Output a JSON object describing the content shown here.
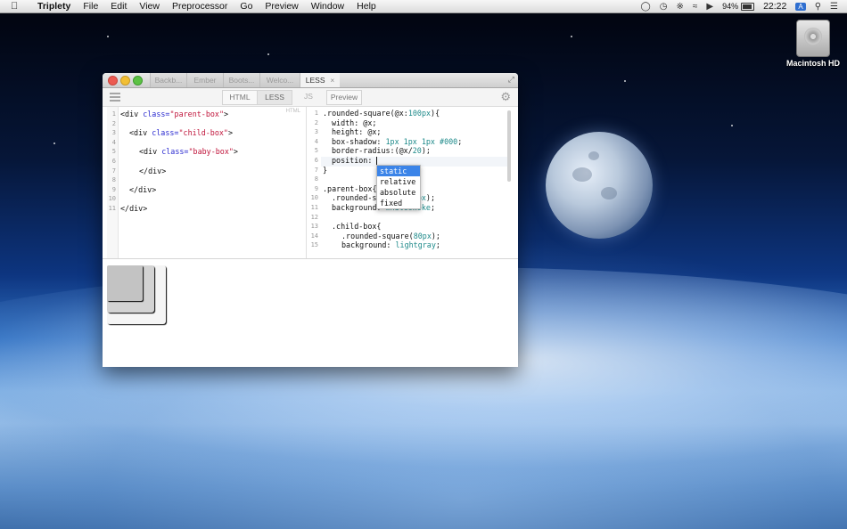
{
  "menubar": {
    "app_name": "Triplety",
    "items": [
      "File",
      "Edit",
      "View",
      "Preprocessor",
      "Go",
      "Preview",
      "Window",
      "Help"
    ],
    "battery": "94%",
    "clock": "22:22",
    "input_badge": "A"
  },
  "desktop": {
    "drive_label": "Macintosh HD"
  },
  "window": {
    "tabs": [
      {
        "label": "Backb..."
      },
      {
        "label": "Ember"
      },
      {
        "label": "Boots..."
      },
      {
        "label": "Welco..."
      },
      {
        "label": "LESS",
        "close": "×"
      }
    ],
    "toolbar": {
      "segments": [
        "HTML",
        "LESS",
        "JS",
        "Preview"
      ]
    },
    "html_pane": {
      "tag": "HTML",
      "lines": [
        {
          "n": "1"
        },
        {
          "n": "2"
        },
        {
          "n": "3"
        },
        {
          "n": "4"
        },
        {
          "n": "5"
        },
        {
          "n": "6"
        },
        {
          "n": "7"
        },
        {
          "n": "8"
        },
        {
          "n": "9"
        },
        {
          "n": "10"
        },
        {
          "n": "11"
        }
      ]
    },
    "less_pane": {
      "line_numbers": [
        "1",
        "2",
        "3",
        "4",
        "5",
        "6",
        "7",
        "8",
        "9",
        "10",
        "11",
        "12",
        "13",
        "14",
        "15"
      ]
    },
    "autocomplete": {
      "options": [
        "static",
        "relative",
        "absolute",
        "fixed"
      ],
      "selected": "static"
    }
  },
  "colors": {
    "accent": "#3b84e8",
    "string": "#c0153b",
    "attribute": "#2b2bd0",
    "number": "#1e8a8a"
  }
}
